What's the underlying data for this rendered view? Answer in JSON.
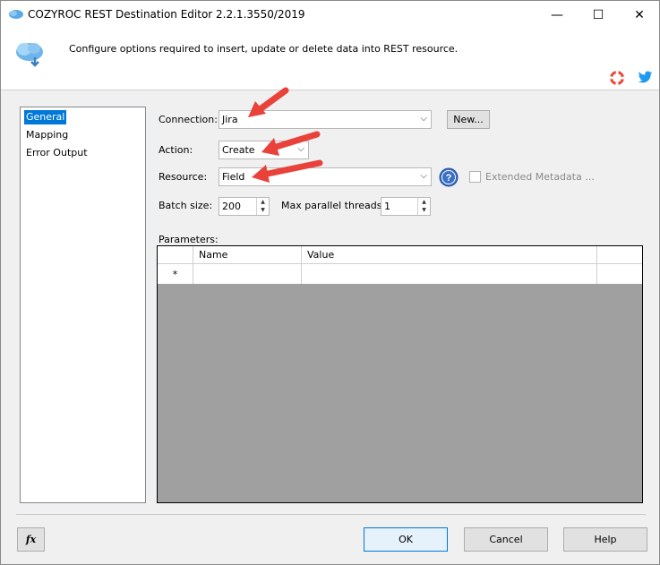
{
  "window": {
    "title": "COZYROC REST Destination Editor 2.2.1.3550/2019",
    "minimize": "—",
    "maximize": "☐",
    "close": "✕"
  },
  "header": {
    "description": "Configure options required to insert, update or delete data into REST resource."
  },
  "nav": {
    "items": [
      {
        "label": "General",
        "selected": true
      },
      {
        "label": "Mapping",
        "selected": false
      },
      {
        "label": "Error Output",
        "selected": false
      }
    ]
  },
  "form": {
    "connection_label": "Connection:",
    "connection_value": "Jira",
    "new_button": "New...",
    "action_label": "Action:",
    "action_value": "Create",
    "resource_label": "Resource:",
    "resource_value": "Field",
    "extended_metadata_label": "Extended Metadata ...",
    "batch_size_label": "Batch size:",
    "batch_size_value": "200",
    "max_threads_label": "Max parallel threads:",
    "max_threads_value": "1",
    "parameters_label": "Parameters:"
  },
  "grid": {
    "columns": [
      "Name",
      "Value"
    ],
    "new_row_marker": "*"
  },
  "footer": {
    "fx_label": "fx",
    "ok": "OK",
    "cancel": "Cancel",
    "help": "Help"
  },
  "colors": {
    "accent": "#0078d7",
    "arrow": "#e8423a"
  }
}
